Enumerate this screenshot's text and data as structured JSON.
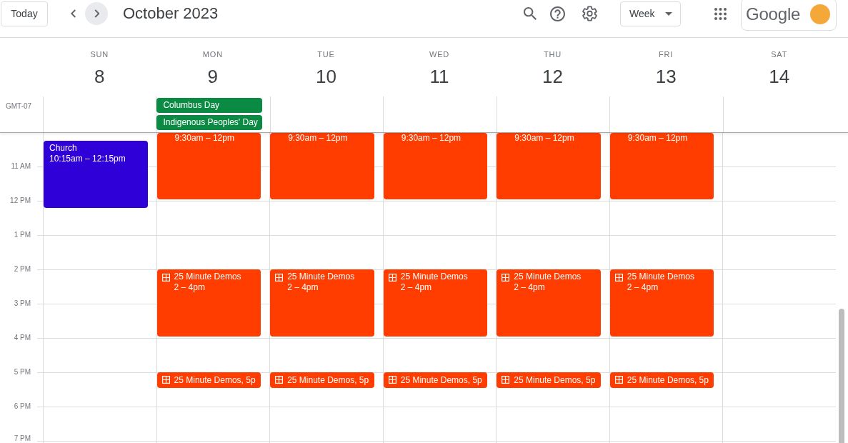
{
  "toolbar": {
    "today_button": "Today",
    "nav_buttons": [
      {
        "kind": "previous",
        "hovered": false
      },
      {
        "kind": "next",
        "hovered": true
      }
    ],
    "title": "October 2023",
    "view_button": "Week",
    "account_logo": "Google"
  },
  "timezone": "GMT-07",
  "hour_labels": [
    "11 AM",
    "12 PM",
    "1 PM",
    "2 PM",
    "3 PM",
    "4 PM",
    "5 PM",
    "6 PM",
    "7 PM"
  ],
  "days": [
    {
      "weekday": "SUN",
      "date": "8",
      "events": [
        {
          "kind": "titled",
          "title": "Church",
          "time": "10:15am – 12:15pm",
          "color": "#3000d9"
        }
      ]
    },
    {
      "weekday": "MON",
      "date": "9",
      "all_day_events": [
        {
          "title": "Columbus Day",
          "color": "#0b8a43"
        },
        {
          "title": "Indigenous Peoples' Day",
          "color": "#0b8a43"
        }
      ],
      "events": [
        {
          "kind": "continued",
          "time": "9:30am – 12pm",
          "color": "#ff3d00"
        },
        {
          "kind": "task",
          "title": "25 Minute Demos",
          "time": "2 – 4pm",
          "color": "#ff3d00"
        },
        {
          "kind": "task_chip",
          "title": "25 Minute Demos, 5p",
          "color": "#ff3d00"
        }
      ]
    },
    {
      "weekday": "TUE",
      "date": "10",
      "events": [
        {
          "kind": "continued",
          "time": "9:30am – 12pm",
          "color": "#ff3d00"
        },
        {
          "kind": "task",
          "title": "25 Minute Demos",
          "time": "2 – 4pm",
          "color": "#ff3d00"
        },
        {
          "kind": "task_chip",
          "title": "25 Minute Demos, 5p",
          "color": "#ff3d00"
        }
      ]
    },
    {
      "weekday": "WED",
      "date": "11",
      "events": [
        {
          "kind": "continued",
          "time": "9:30am – 12pm",
          "color": "#ff3d00"
        },
        {
          "kind": "task",
          "title": "25 Minute Demos",
          "time": "2 – 4pm",
          "color": "#ff3d00"
        },
        {
          "kind": "task_chip",
          "title": "25 Minute Demos, 5p",
          "color": "#ff3d00"
        }
      ]
    },
    {
      "weekday": "THU",
      "date": "12",
      "events": [
        {
          "kind": "continued",
          "time": "9:30am – 12pm",
          "color": "#ff3d00"
        },
        {
          "kind": "task",
          "title": "25 Minute Demos",
          "time": "2 – 4pm",
          "color": "#ff3d00"
        },
        {
          "kind": "task_chip",
          "title": "25 Minute Demos, 5p",
          "color": "#ff3d00"
        }
      ]
    },
    {
      "weekday": "FRI",
      "date": "13",
      "events": [
        {
          "kind": "continued",
          "time": "9:30am – 12pm",
          "color": "#ff3d00"
        },
        {
          "kind": "task",
          "title": "25 Minute Demos",
          "time": "2 – 4pm",
          "color": "#ff3d00"
        },
        {
          "kind": "task_chip",
          "title": "25 Minute Demos, 5p",
          "color": "#ff3d00"
        }
      ]
    },
    {
      "weekday": "SAT",
      "date": "14"
    }
  ]
}
